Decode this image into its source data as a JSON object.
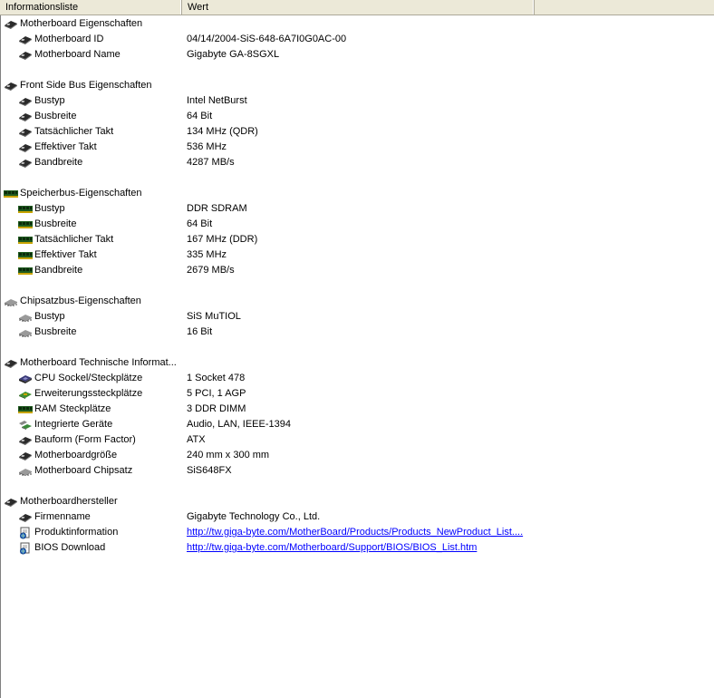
{
  "header": {
    "col1": "Informationsliste",
    "col2": "Wert"
  },
  "groups": [
    {
      "title": "Motherboard Eigenschaften",
      "icon": "board-icon",
      "items": [
        {
          "label": "Motherboard ID",
          "value": "04/14/2004-SiS-648-6A7I0G0AC-00",
          "icon": "board-icon"
        },
        {
          "label": "Motherboard Name",
          "value": "Gigabyte GA-8SGXL",
          "icon": "board-icon"
        }
      ]
    },
    {
      "title": "Front Side Bus Eigenschaften",
      "icon": "board-icon",
      "items": [
        {
          "label": "Bustyp",
          "value": "Intel NetBurst",
          "icon": "board-icon"
        },
        {
          "label": "Busbreite",
          "value": "64 Bit",
          "icon": "board-icon"
        },
        {
          "label": "Tatsächlicher Takt",
          "value": "134 MHz (QDR)",
          "icon": "board-icon"
        },
        {
          "label": "Effektiver Takt",
          "value": "536 MHz",
          "icon": "board-icon"
        },
        {
          "label": "Bandbreite",
          "value": "4287 MB/s",
          "icon": "board-icon"
        }
      ]
    },
    {
      "title": "Speicherbus-Eigenschaften",
      "icon": "ram-icon",
      "items": [
        {
          "label": "Bustyp",
          "value": "DDR SDRAM",
          "icon": "ram-icon"
        },
        {
          "label": "Busbreite",
          "value": "64 Bit",
          "icon": "ram-icon"
        },
        {
          "label": "Tatsächlicher Takt",
          "value": "167 MHz (DDR)",
          "icon": "ram-icon"
        },
        {
          "label": "Effektiver Takt",
          "value": "335 MHz",
          "icon": "ram-icon"
        },
        {
          "label": "Bandbreite",
          "value": "2679 MB/s",
          "icon": "ram-icon"
        }
      ]
    },
    {
      "title": "Chipsatzbus-Eigenschaften",
      "icon": "chipset-icon",
      "items": [
        {
          "label": "Bustyp",
          "value": "SiS MuTIOL",
          "icon": "chipset-icon"
        },
        {
          "label": "Busbreite",
          "value": "16 Bit",
          "icon": "chipset-icon"
        }
      ]
    },
    {
      "title": "Motherboard Technische Informat...",
      "icon": "board-icon",
      "items": [
        {
          "label": "CPU Sockel/Steckplätze",
          "value": "1 Socket 478",
          "icon": "cpu-icon"
        },
        {
          "label": "Erweiterungssteckplätze",
          "value": "5 PCI, 1 AGP",
          "icon": "card-icon"
        },
        {
          "label": "RAM Steckplätze",
          "value": "3 DDR DIMM",
          "icon": "ram-icon"
        },
        {
          "label": "Integrierte Geräte",
          "value": "Audio, LAN, IEEE-1394",
          "icon": "devices-icon"
        },
        {
          "label": "Bauform (Form Factor)",
          "value": "ATX",
          "icon": "board-icon"
        },
        {
          "label": "Motherboardgröße",
          "value": "240 mm x 300 mm",
          "icon": "board-icon"
        },
        {
          "label": "Motherboard Chipsatz",
          "value": "SiS648FX",
          "icon": "chipset-icon"
        }
      ]
    },
    {
      "title": "Motherboardhersteller",
      "icon": "board-icon",
      "items": [
        {
          "label": "Firmenname",
          "value": "Gigabyte Technology Co., Ltd.",
          "icon": "board-icon"
        },
        {
          "label": "Produktinformation",
          "value": "http://tw.giga-byte.com/MotherBoard/Products/Products_NewProduct_List....",
          "icon": "web-page-icon",
          "link": true
        },
        {
          "label": "BIOS Download",
          "value": "http://tw.giga-byte.com/Motherboard/Support/BIOS/BIOS_List.htm",
          "icon": "web-page-icon",
          "link": true
        }
      ]
    }
  ]
}
